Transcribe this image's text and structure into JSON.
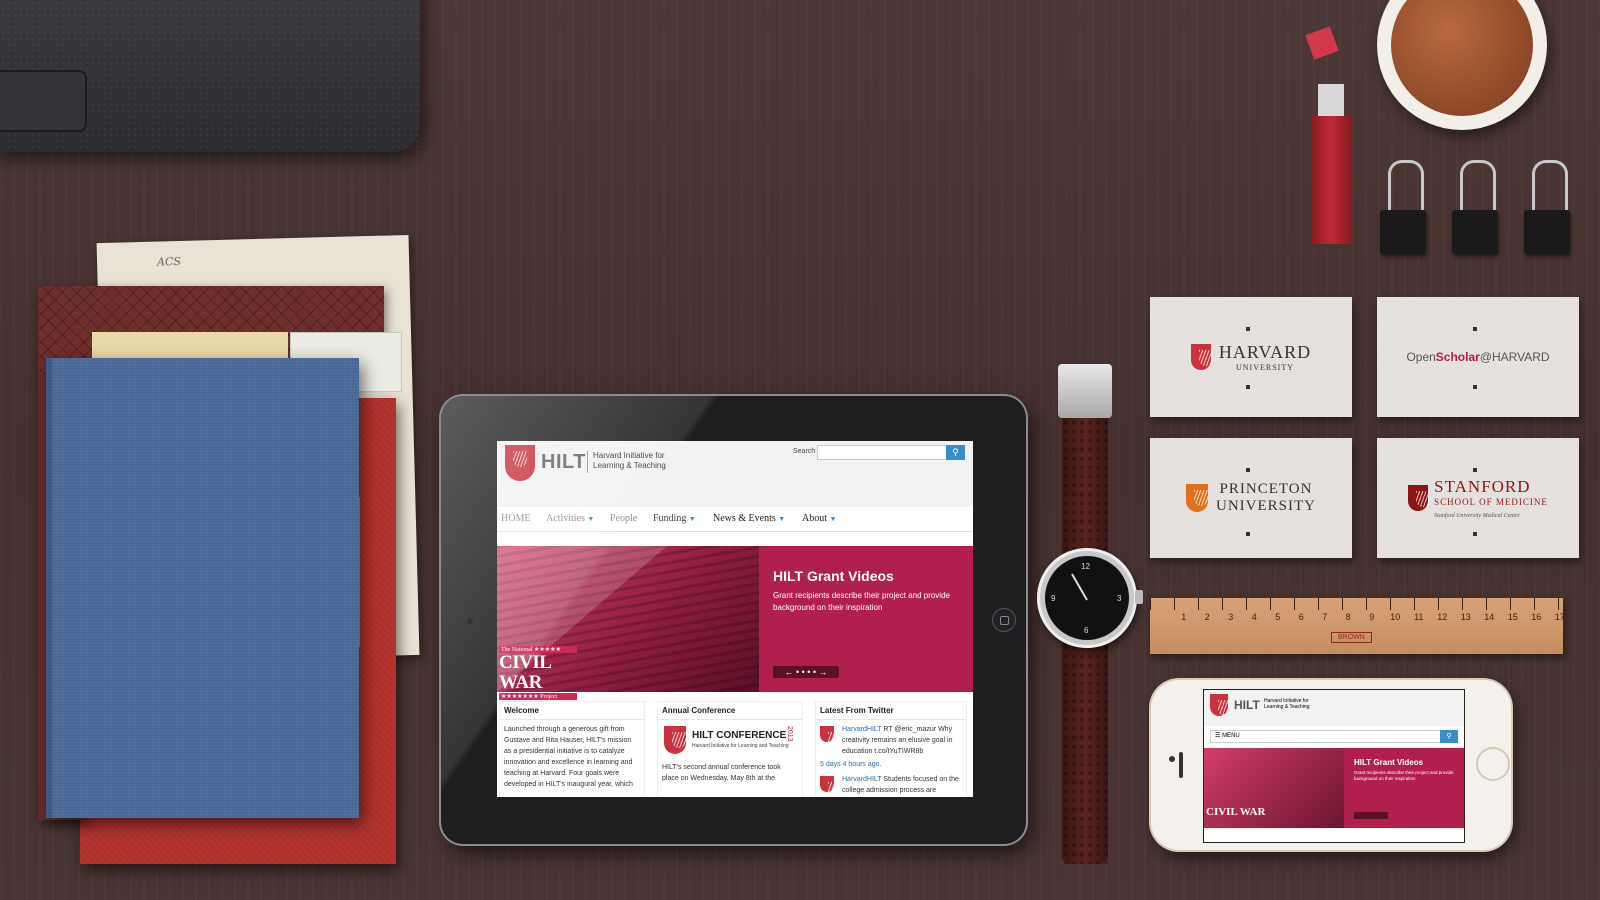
{
  "scene": {
    "background_color": "#4a3634",
    "scribble_text": "ACS"
  },
  "tablet_site": {
    "logo": {
      "name": "HILT",
      "subtitle_line1": "Harvard Initiative for",
      "subtitle_line2": "Learning & Teaching"
    },
    "search": {
      "label": "Search",
      "placeholder": ""
    },
    "nav": [
      {
        "label": "HOME"
      },
      {
        "label": "Activities",
        "has_dropdown": true
      },
      {
        "label": "People"
      },
      {
        "label": "Funding",
        "has_dropdown": true
      },
      {
        "label": "News & Events",
        "has_dropdown": true
      },
      {
        "label": "About",
        "has_dropdown": true
      }
    ],
    "hero": {
      "badge_small": "The National ★★★★★",
      "badge_big": "CIVIL WAR",
      "badge_foot": "★★★★★★★ Project",
      "title": "HILT Grant Videos",
      "description": "Grant recipients describe their project and provide background on their inspiration",
      "pager": "← • • • • →"
    },
    "columns": {
      "welcome": {
        "title": "Welcome",
        "text": "Launched through a generous gift from Gustave and Rita Hauser, HILT's mission as a presidential initiative is to catalyze innovation and excellence in learning and teaching at Harvard. Four goals were developed in HILT's inaugural year, which"
      },
      "conference": {
        "title": "Annual Conference",
        "logo_title": "HILT CONFERENCE",
        "logo_sub": "Harvard Initiative for Learning and Teaching",
        "logo_year": "2013",
        "text": "HILT's second annual conference took place on Wednesday, May 8th at the"
      },
      "twitter": {
        "title": "Latest From Twitter",
        "tweet1_user": "HarvardHILT",
        "tweet1_text": "RT @eric_mazur Why creativity remains an elusive goal in education t.co/tYuTIWR8b",
        "tweet1_time": "5 days 4 hours ago.",
        "tweet2_user": "HarvardHILT",
        "tweet2_text": "Students focused on the college admission process are"
      }
    },
    "colors": {
      "accent": "#b11f4f",
      "search_button": "#3a8ec6"
    }
  },
  "business_cards": [
    {
      "text": "HARVARD",
      "sub": "UNIVERSITY"
    },
    {
      "text_a": "Open",
      "text_b": "Scholar",
      "text_c": "@HARVARD"
    },
    {
      "text": "PRINCETON",
      "sub": "UNIVERSITY"
    },
    {
      "text": "STANFORD",
      "sub": "SCHOOL OF MEDICINE",
      "foot": "Stanford University Medical Center"
    }
  ],
  "ruler": {
    "numbers": [
      "1",
      "2",
      "3",
      "4",
      "5",
      "6",
      "7",
      "8",
      "9",
      "10",
      "11",
      "12",
      "13",
      "14",
      "15",
      "16",
      "17"
    ],
    "brand": "BROWN"
  },
  "watch": {
    "numerals": [
      "12",
      "3",
      "6",
      "9"
    ]
  },
  "phone_site": {
    "logo": "HILT",
    "logo_sub_line1": "Harvard Initiative for",
    "logo_sub_line2": "Learning & Teaching",
    "menu_label": "MENU",
    "hero_title": "HILT Grant Videos",
    "hero_desc": "Grant recipients describe their project and provide background on their inspiration",
    "badge_big": "CIVIL WAR"
  }
}
